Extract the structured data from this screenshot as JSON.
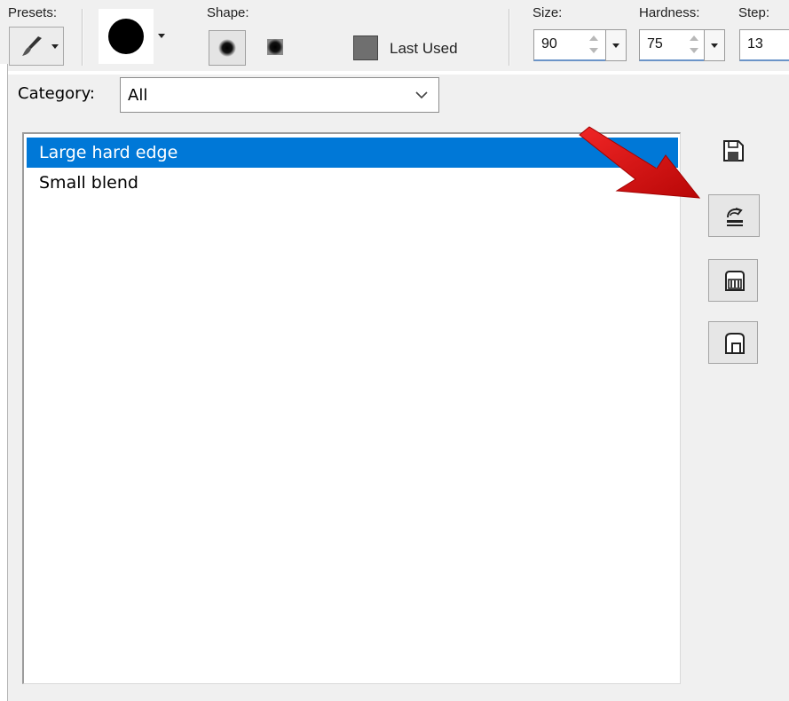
{
  "toolbar": {
    "presets_label": "Presets:",
    "shape_label": "Shape:",
    "last_used_label": "Last Used",
    "size_label": "Size:",
    "size_value": "90",
    "hardness_label": "Hardness:",
    "hardness_value": "75",
    "step_label": "Step:",
    "step_value": "13"
  },
  "dialog": {
    "category_label": "Category:",
    "category_value": "All",
    "presets": [
      {
        "label": "Large hard edge",
        "selected": true
      },
      {
        "label": "Small blend",
        "selected": false
      }
    ],
    "side_buttons": [
      {
        "icon": "save-icon"
      },
      {
        "icon": "load-preset-icon",
        "highlighted": true
      },
      {
        "icon": "save-as-icon"
      },
      {
        "icon": "delete-preset-icon"
      }
    ]
  },
  "colors": {
    "selection": "#0078d7",
    "annotation_arrow": "#d90c0c",
    "dialog_bg": "#f0f0f0"
  }
}
